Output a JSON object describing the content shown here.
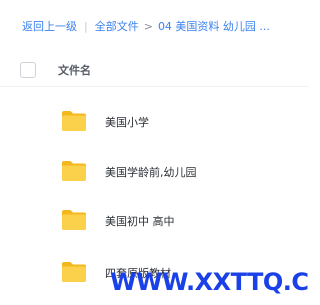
{
  "breadcrumb": {
    "back": "返回上一级",
    "all_files": "全部文件",
    "current": "04 美国资料 幼儿园 ..."
  },
  "list_header": {
    "name_column": "文件名"
  },
  "files": [
    {
      "name": "美国小学",
      "icon": "folder-icon"
    },
    {
      "name": "美国学龄前,幼儿园",
      "icon": "folder-icon"
    },
    {
      "name": "美国初中 高中",
      "icon": "folder-icon"
    },
    {
      "name": "四套原版教材",
      "icon": "folder-icon"
    }
  ],
  "watermark": "WWW.XXTTQ.COM",
  "colors": {
    "link": "#3c82f0",
    "folder": "#f8c832",
    "watermark": "#1a40e8"
  }
}
